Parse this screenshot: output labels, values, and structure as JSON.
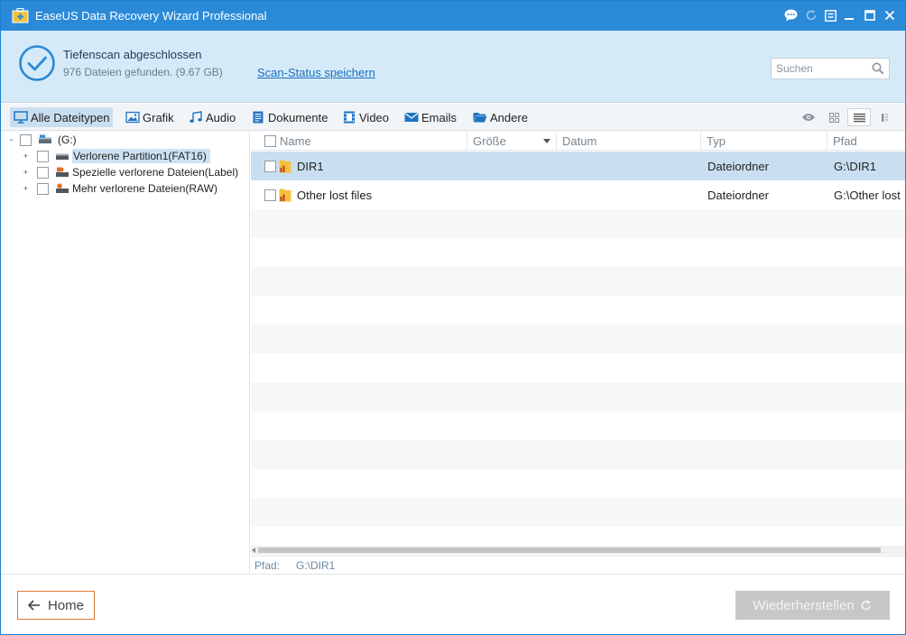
{
  "window": {
    "title": "EaseUS Data Recovery Wizard Professional"
  },
  "status": {
    "title": "Tiefenscan abgeschlossen",
    "subtitle": "976 Dateien gefunden. (9.67 GB)",
    "save_link": "Scan-Status speichern"
  },
  "search": {
    "placeholder": "Suchen"
  },
  "filters": [
    {
      "label": "Alle Dateitypen",
      "icon": "monitor-icon",
      "active": true
    },
    {
      "label": "Grafik",
      "icon": "image-icon",
      "active": false
    },
    {
      "label": "Audio",
      "icon": "music-note-icon",
      "active": false
    },
    {
      "label": "Dokumente",
      "icon": "document-icon",
      "active": false
    },
    {
      "label": "Video",
      "icon": "film-icon",
      "active": false
    },
    {
      "label": "Emails",
      "icon": "envelope-icon",
      "active": false
    },
    {
      "label": "Andere",
      "icon": "folder-open-icon",
      "active": false
    }
  ],
  "view_modes": [
    {
      "icon": "eye-icon",
      "active": false
    },
    {
      "icon": "grid-view-icon",
      "active": false
    },
    {
      "icon": "list-view-icon",
      "active": true
    },
    {
      "icon": "detail-view-icon",
      "active": false
    }
  ],
  "tree": {
    "root": {
      "label": "(G:)",
      "toggle": "−"
    },
    "children": [
      {
        "label": "Verlorene Partition1(FAT16)",
        "toggle": "+",
        "selected": true
      },
      {
        "label": "Spezielle verlorene Dateien(Label)",
        "toggle": "+",
        "selected": false
      },
      {
        "label": "Mehr verlorene Dateien(RAW)",
        "toggle": "+",
        "selected": false
      }
    ]
  },
  "list": {
    "columns": [
      "Name",
      "Größe",
      "Datum",
      "Typ",
      "Pfad"
    ],
    "rows": [
      {
        "name": "DIR1",
        "size": "",
        "date": "",
        "type": "Dateiordner",
        "path": "G:\\DIR1"
      },
      {
        "name": "Other lost files",
        "size": "",
        "date": "",
        "type": "Dateiordner",
        "path": "G:\\Other lost"
      }
    ]
  },
  "path_bar": {
    "label": "Pfad:",
    "value": "G:\\DIR1"
  },
  "footer": {
    "home_label": "Home",
    "restore_label": "Wiederherstellen"
  },
  "colors": {
    "titlebar": "#2b8ad8",
    "header_bg": "#d5eaf8",
    "selection": "#c9dff1",
    "home_border": "#e07a2f",
    "restore_disabled": "#c7c7c7"
  }
}
